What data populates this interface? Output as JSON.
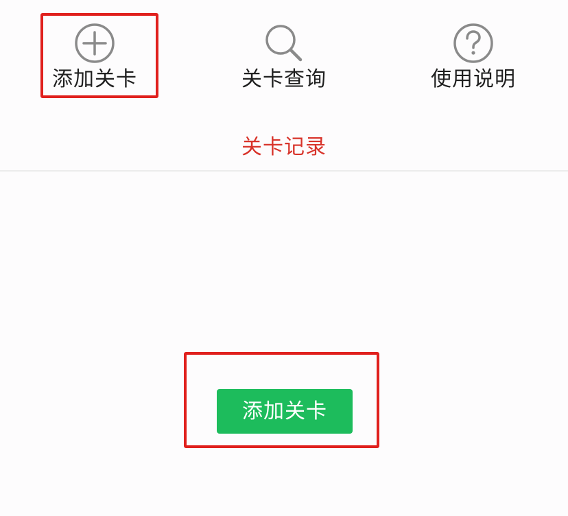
{
  "nav": {
    "items": [
      {
        "label": "添加关卡",
        "icon": "plus-circle-icon"
      },
      {
        "label": "关卡查询",
        "icon": "search-icon"
      },
      {
        "label": "使用说明",
        "icon": "question-circle-icon"
      }
    ]
  },
  "tabs": {
    "record_label": "关卡记录"
  },
  "main": {
    "add_button_label": "添加关卡"
  },
  "colors": {
    "accent_red": "#d8332a",
    "highlight_red": "#e0201d",
    "button_green": "#1dbc5c",
    "icon_gray": "#8a8a8a"
  }
}
